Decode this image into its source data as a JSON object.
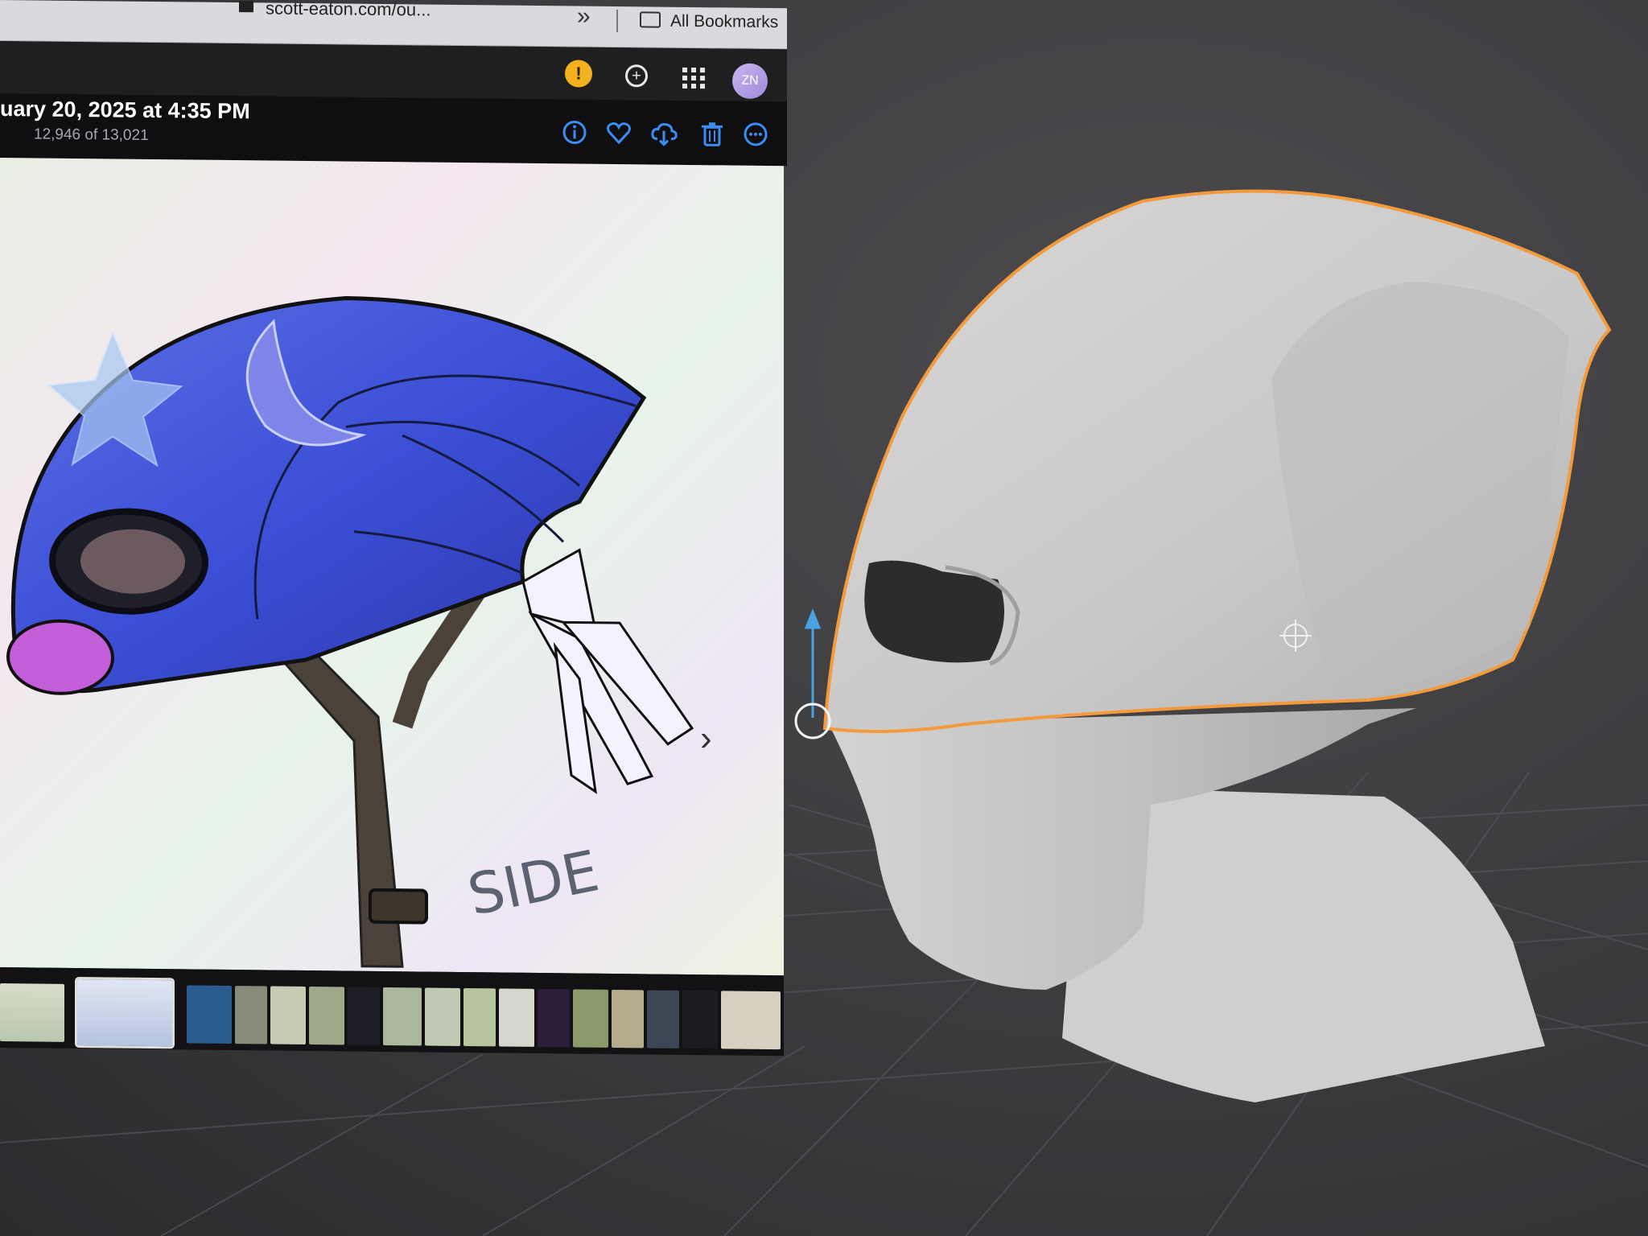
{
  "browser": {
    "tab_url": "scott-eaton.com/ou...",
    "overflow_chevron": "»",
    "bookmarks_label": "All Bookmarks"
  },
  "toolbar": {
    "warning_icon": "warning-icon",
    "add_icon": "add-circle-icon",
    "apps_icon": "apps-grid-icon",
    "avatar_initials": "ZN"
  },
  "photo_viewer": {
    "date": "uary 20, 2025 at 4:35 PM",
    "count": "12,946 of 13,021",
    "actions": [
      "info-icon",
      "heart-icon",
      "download-cloud-icon",
      "trash-icon",
      "more-icon"
    ],
    "next_arrow": "›",
    "sketch_label": "SIDE"
  },
  "viewport": {
    "selection_color": "#f39a3c",
    "gizmo_color": "#4aa3e0"
  }
}
